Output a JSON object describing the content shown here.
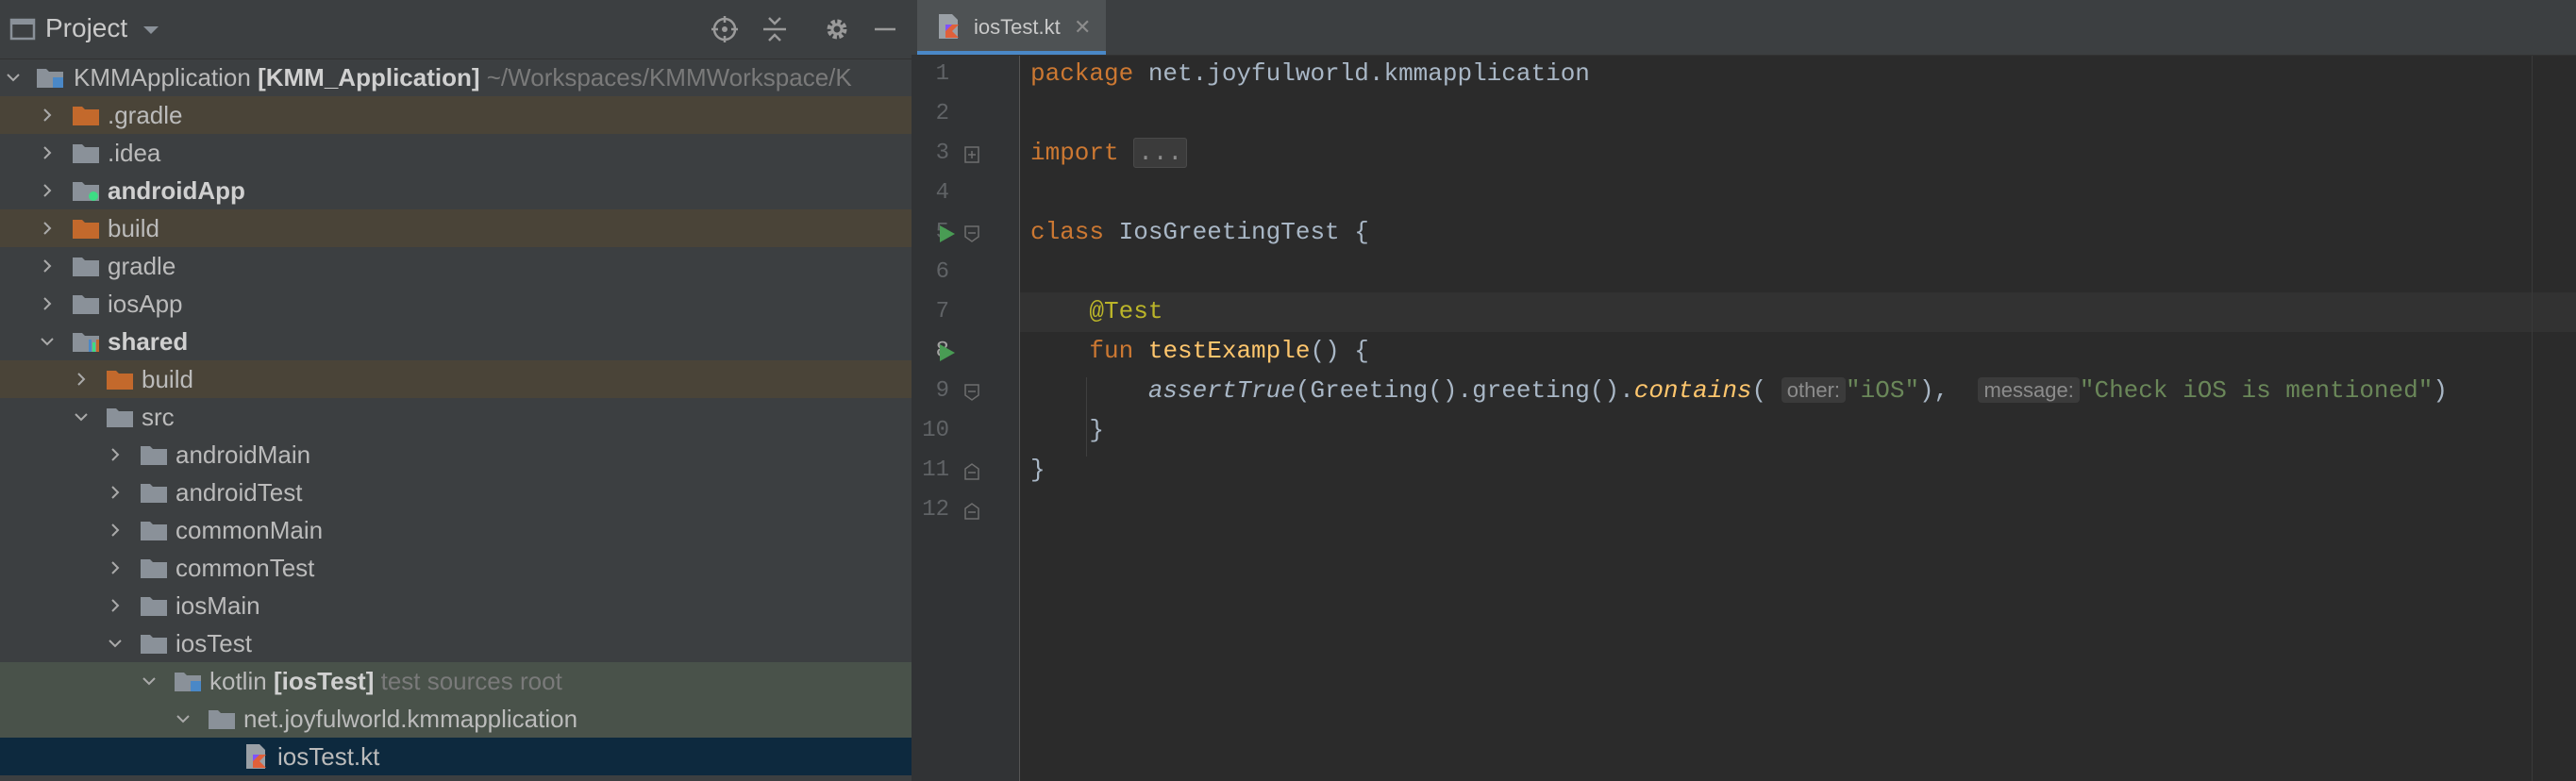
{
  "project_panel": {
    "title": "Project",
    "tree": [
      {
        "name": "KMMApplication",
        "suffix_bold": "[KMM_Application]",
        "suffix_path": "~/Workspaces/KMMWorkspace/K"
      },
      {
        "name": ".gradle"
      },
      {
        "name": ".idea"
      },
      {
        "name": "androidApp"
      },
      {
        "name": "build"
      },
      {
        "name": "gradle"
      },
      {
        "name": "iosApp"
      },
      {
        "name": "shared"
      },
      {
        "name": "build"
      },
      {
        "name": "src"
      },
      {
        "name": "androidMain"
      },
      {
        "name": "androidTest"
      },
      {
        "name": "commonMain"
      },
      {
        "name": "commonTest"
      },
      {
        "name": "iosMain"
      },
      {
        "name": "iosTest"
      },
      {
        "name": "kotlin",
        "suffix_bold": "[iosTest]",
        "suffix_note": "test sources root"
      },
      {
        "name": "net.joyfulworld.kmmapplication"
      },
      {
        "name": "iosTest.kt"
      }
    ]
  },
  "editor": {
    "tab": {
      "label": "iosTest.kt"
    },
    "line_numbers": [
      "1",
      "2",
      "3",
      "4",
      "5",
      "6",
      "7",
      "8",
      "9",
      "10",
      "11",
      "12"
    ],
    "code": {
      "l1_kw": "package",
      "l1_rest": " net.joyfulworld.kmmapplication",
      "l3_kw": "import",
      "l3_fold": "...",
      "l6_kw": "class",
      "l6_rest": " IosGreetingTest {",
      "l8_ann": "@Test",
      "l9_kw": "fun",
      "l9_fn": "testExample",
      "l9_rest": "() {",
      "l10_fn": "assertTrue",
      "l10_a": "(Greeting().greeting().",
      "l10_fn2": "contains",
      "l10_b": "(",
      "l10_hint1": "other:",
      "l10_str1": "\"iOS\"",
      "l10_c": "),",
      "l10_hint2": "message:",
      "l10_str2": "\"Check iOS is mentioned\"",
      "l10_d": ")",
      "l11": "}",
      "l12": "}"
    }
  },
  "colors": {
    "keyword": "#cc7832",
    "annotation": "#bbb529",
    "function": "#ffc66d",
    "string": "#6a8759",
    "run": "#499c54",
    "folder": "#8a9199",
    "excluded_folder": "#c3692c"
  }
}
